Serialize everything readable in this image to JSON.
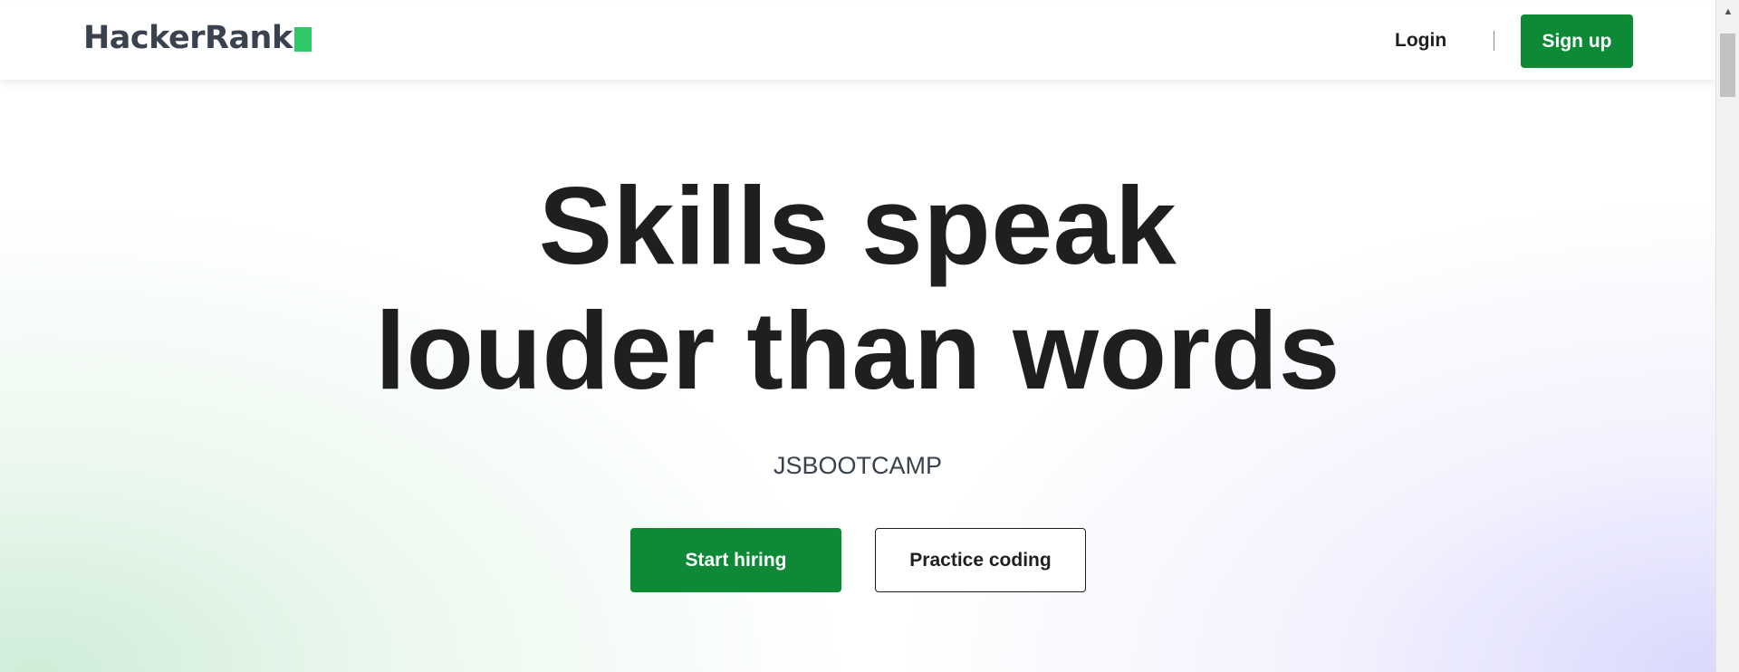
{
  "header": {
    "logo_text": "HackerRank",
    "login_label": "Login",
    "signup_label": "Sign up"
  },
  "hero": {
    "title_line1": "Skills speak",
    "title_line2": "louder than words",
    "subtitle": "JSBOOTCAMP",
    "start_hiring_label": "Start hiring",
    "practice_coding_label": "Practice coding"
  },
  "scrollbar": {
    "up_arrow": "▲"
  },
  "colors": {
    "brand_green": "#0e8936",
    "logo_green": "#2ec866",
    "text_dark": "#1f1f1f",
    "logo_text": "#39424e"
  },
  "icons": {
    "logo_mark": "green-square-icon",
    "scroll_up": "triangle-up-icon"
  }
}
